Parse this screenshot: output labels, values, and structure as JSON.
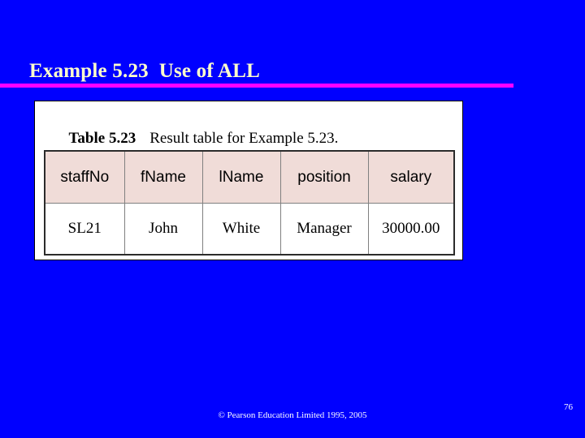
{
  "slide": {
    "title": "Example 5.23  Use of ALL",
    "accent_rule_color": "#ff00ff",
    "background_color": "#0000ff",
    "title_color": "#ffffcc"
  },
  "table_panel": {
    "caption_label": "Table 5.23",
    "caption_text": "Result table for Example 5.23.",
    "header_background_color": "#f0dcd8",
    "columns": [
      {
        "key": "staffNo",
        "label": "staffNo"
      },
      {
        "key": "fName",
        "label": "fName"
      },
      {
        "key": "lName",
        "label": "lName"
      },
      {
        "key": "position",
        "label": "position"
      },
      {
        "key": "salary",
        "label": "salary"
      }
    ],
    "rows": [
      {
        "staffNo": "SL21",
        "fName": "John",
        "lName": "White",
        "position": "Manager",
        "salary": "30000.00"
      }
    ]
  },
  "footer": {
    "copyright": "© Pearson Education Limited 1995, 2005",
    "page_number": "76"
  }
}
